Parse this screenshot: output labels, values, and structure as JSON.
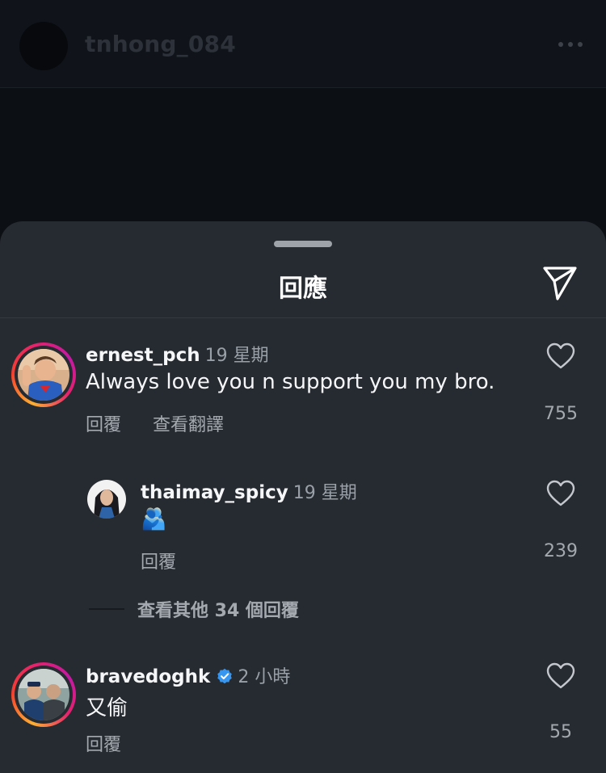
{
  "header": {
    "username": "tnhong_084"
  },
  "sheet": {
    "title": "回應"
  },
  "comments": [
    {
      "username": "ernest_pch",
      "time": "19 星期",
      "text": "Always love you n support you my bro.",
      "reply_label": "回覆",
      "translate_label": "查看翻譯",
      "likes": "755"
    },
    {
      "username": "thaimay_spicy",
      "time": "19 星期",
      "text": "🫂",
      "reply_label": "回覆",
      "likes": "239"
    },
    {
      "username": "bravedoghk",
      "verified": true,
      "time": "2 小時",
      "text": "又偷",
      "reply_label": "回覆",
      "likes": "55"
    }
  ],
  "view_more_replies": "查看其他 34 個回覆",
  "colors": {
    "verified_badge": "#3797f0",
    "sheet_background": "#262a31"
  }
}
